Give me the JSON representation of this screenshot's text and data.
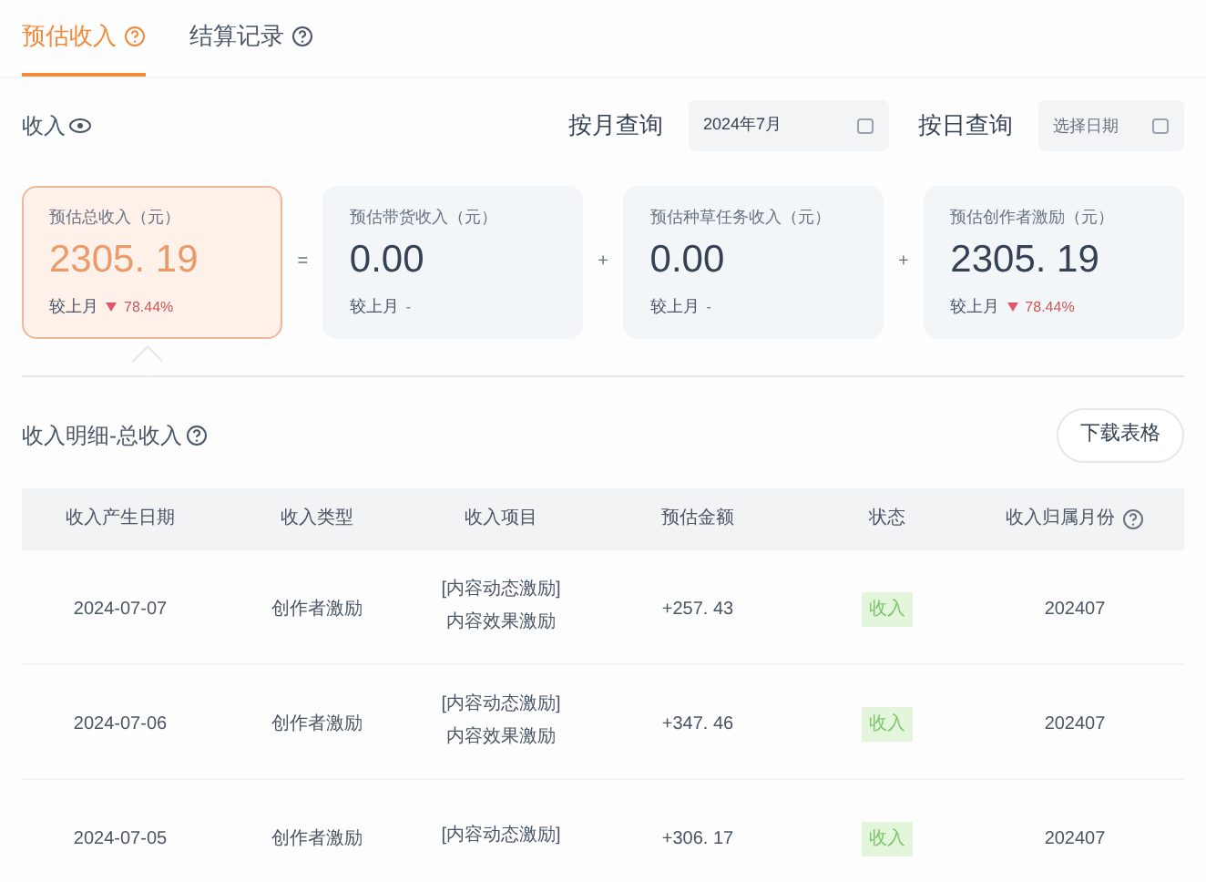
{
  "tabs": [
    {
      "label": "预估收入",
      "selected": true
    },
    {
      "label": "结算记录",
      "selected": false
    }
  ],
  "income": {
    "title": "收入",
    "month_query": {
      "label": "按月查询",
      "value": "2024年7月"
    },
    "day_query": {
      "label": "按日查询",
      "placeholder": "选择日期"
    }
  },
  "cards": [
    {
      "title": "预估总收入（元）",
      "value": "2305. 19",
      "compare_label": "较上月",
      "down": true,
      "change": "78.44%",
      "selected": true
    },
    {
      "title": "预估带货收入（元）",
      "value": "0.00",
      "compare_label": "较上月",
      "down": false,
      "change": "-",
      "selected": false
    },
    {
      "title": "预估种草任务收入（元）",
      "value": "0.00",
      "compare_label": "较上月",
      "down": false,
      "change": "-",
      "selected": false
    },
    {
      "title": "预估创作者激励（元）",
      "value": "2305. 19",
      "compare_label": "较上月",
      "down": true,
      "change": "78.44%",
      "selected": false
    }
  ],
  "operators": [
    "=",
    "+",
    "+"
  ],
  "detail": {
    "title": "收入明细-总收入",
    "download_button": "下载表格"
  },
  "table": {
    "columns": [
      "收入产生日期",
      "收入类型",
      "收入项目",
      "预估金额",
      "状态",
      "收入归属月份"
    ],
    "rows": [
      {
        "date": "2024-07-07",
        "type": "创作者激励",
        "items": [
          "[内容动态激励]",
          "内容效果激励"
        ],
        "amount": "+257. 43",
        "status": "收入",
        "month": "202407"
      },
      {
        "date": "2024-07-06",
        "type": "创作者激励",
        "items": [
          "[内容动态激励]",
          "内容效果激励"
        ],
        "amount": "+347. 46",
        "status": "收入",
        "month": "202407"
      },
      {
        "date": "2024-07-05",
        "type": "创作者激励",
        "items": [
          "[内容动态激励]"
        ],
        "amount": "+306. 17",
        "status": "收入",
        "month": "202407"
      }
    ]
  }
}
